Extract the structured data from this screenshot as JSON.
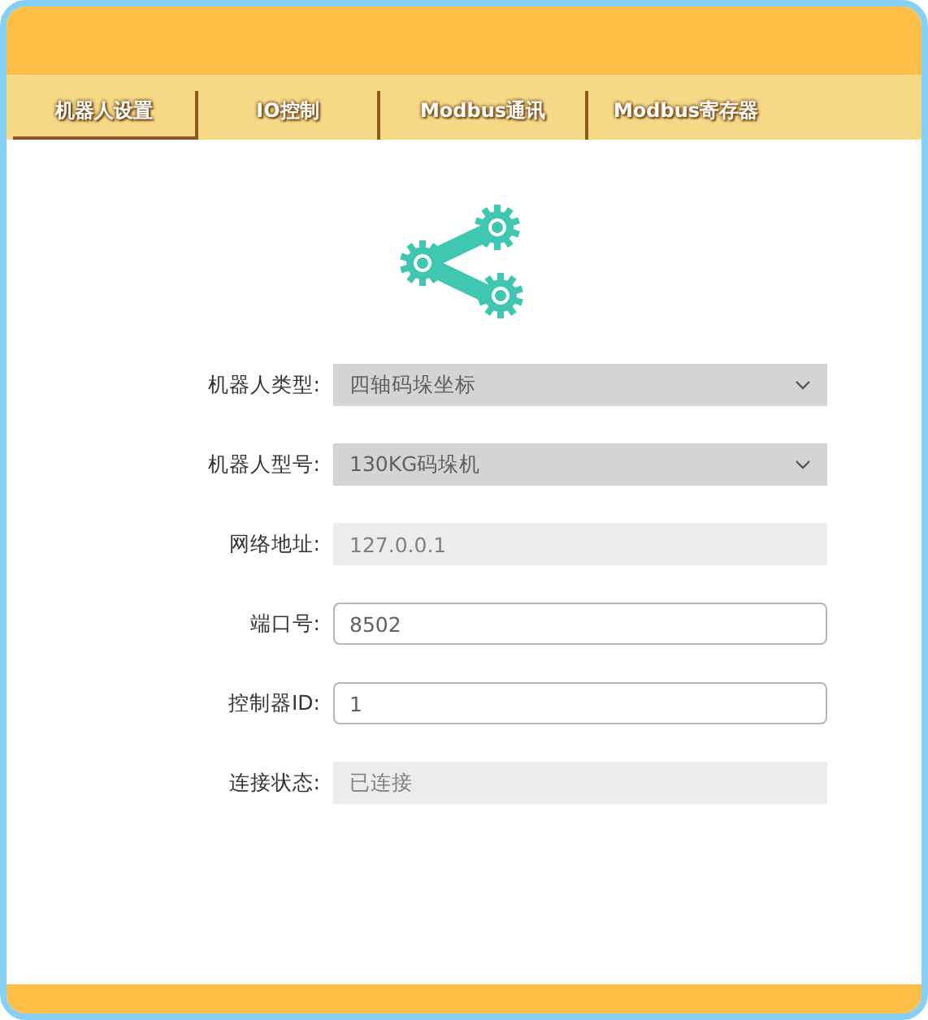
{
  "tabs": [
    {
      "label": "机器人设置",
      "selected": true
    },
    {
      "label": "IO控制",
      "selected": false
    },
    {
      "label": "Modbus通讯",
      "selected": false
    },
    {
      "label": "Modbus寄存器",
      "selected": false
    }
  ],
  "form": [
    {
      "kind": "select",
      "label": "机器人类型:",
      "value": "四轴码垛坐标"
    },
    {
      "kind": "select",
      "label": "机器人型号:",
      "value": "130KG码垛机"
    },
    {
      "kind": "readonly",
      "label": "网络地址:",
      "value": "127.0.0.1"
    },
    {
      "kind": "input",
      "label": "端口号:",
      "value": "8502"
    },
    {
      "kind": "input",
      "label": "控制器ID:",
      "value": "1"
    },
    {
      "kind": "readonly",
      "label": "连接状态:",
      "value": "已连接"
    }
  ]
}
